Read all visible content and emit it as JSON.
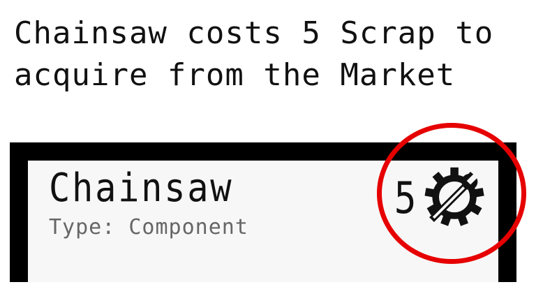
{
  "caption": "Chainsaw costs 5 Scrap to acquire from the Market",
  "card": {
    "title": "Chainsaw",
    "type_line": "Type: Component",
    "cost": "5",
    "cost_icon": "scrap-gear-wrench-icon"
  },
  "colors": {
    "highlight": "#e60000",
    "frame": "#000000",
    "card_bg": "#f7f7f7",
    "type_text": "#666666"
  }
}
